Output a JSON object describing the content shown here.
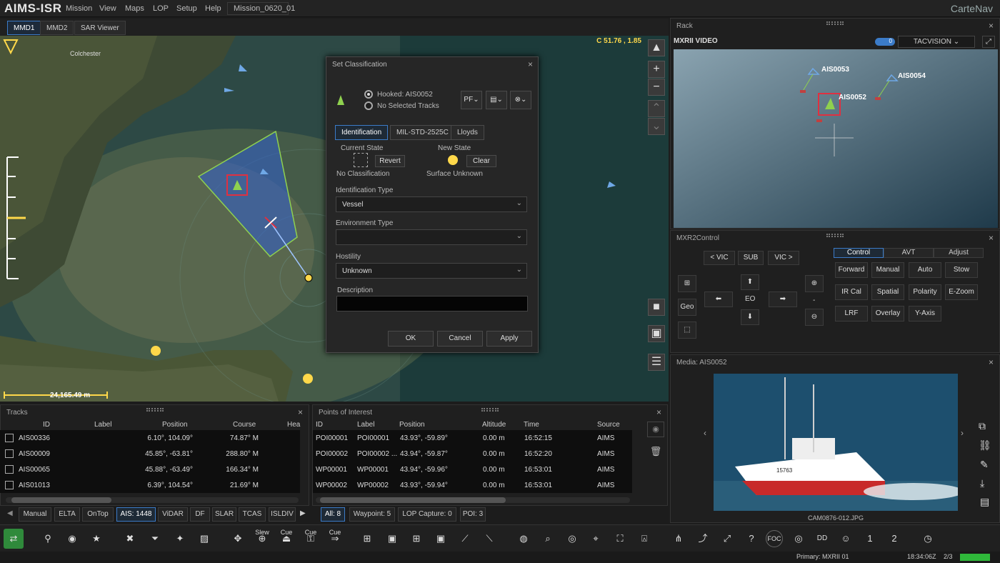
{
  "app": {
    "title": "AIMS-ISR",
    "menu": [
      "Mission",
      "View",
      "Maps",
      "LOP",
      "Setup",
      "Help"
    ],
    "mission": "Mission_0620_01",
    "brand": "CarteNav"
  },
  "map_tabs": [
    "MMD1",
    "MMD2",
    "SAR Viewer"
  ],
  "map": {
    "coordinate": "C 51.76  , 1.85",
    "scale": "24,165.49 m",
    "place_label": "Colchester"
  },
  "dialog": {
    "title": "Set Classification",
    "radio_hooked": "Hooked: AIS0052",
    "radio_none": "No Selected Tracks",
    "pf_label": "PF",
    "tabs": [
      "Identification",
      "MIL-STD-2525C",
      "Lloyds"
    ],
    "current_state_label": "Current State",
    "new_state_label": "New State",
    "revert": "Revert",
    "clear": "Clear",
    "current_state_value": "No Classification",
    "new_state_value": "Surface Unknown",
    "id_type_label": "Identification Type",
    "id_type_value": "Vessel",
    "env_type_label": "Environment Type",
    "env_type_value": "",
    "hostility_label": "Hostility",
    "hostility_value": "Unknown",
    "description_label": "Description",
    "ok": "OK",
    "cancel": "Cancel",
    "apply": "Apply"
  },
  "rack": {
    "title": "Rack",
    "video_title": "MXRII VIDEO",
    "toggle": "0",
    "dropdown": "TACVISION",
    "tracks": [
      "AIS0053",
      "AIS0054",
      "AIS0052"
    ]
  },
  "control": {
    "title": "MXR2Control",
    "nav": [
      "< VIC",
      "SUB",
      "VIC >"
    ],
    "tabs": [
      "Control",
      "AVT",
      "Adjust"
    ],
    "geo": "Geo",
    "eo": "EO",
    "minus": "-",
    "buttons": [
      [
        "Forward",
        "Manual",
        "Auto",
        "Stow"
      ],
      [
        "IR Cal",
        "Spatial",
        "Polarity",
        "E-Zoom"
      ],
      [
        "LRF",
        "Overlay",
        "Y-Axis"
      ]
    ]
  },
  "media": {
    "title": "Media: AIS0052",
    "filename": "CAM0876-012.JPG",
    "hull_number": "15763"
  },
  "tracks_panel": {
    "title": "Tracks",
    "columns": [
      "ID",
      "Label",
      "Position",
      "Course",
      "Hea"
    ],
    "rows": [
      [
        "AIS00336",
        "",
        "6.10°, 104.09°",
        "74.87° M"
      ],
      [
        "AIS00009",
        "",
        "45.85°, -63.81°",
        "288.80° M"
      ],
      [
        "AIS00065",
        "",
        "45.88°, -63.49°",
        "166.34° M"
      ],
      [
        "AIS01013",
        "",
        "6.39°, 104.54°",
        "21.69° M"
      ]
    ],
    "tabs": [
      "Manual",
      "ELTA",
      "OnTop",
      "AIS: 1448",
      "ViDAR",
      "DF",
      "SLAR",
      "TCAS",
      "ISLDIV"
    ]
  },
  "poi_panel": {
    "title": "Points of Interest",
    "columns": [
      "ID",
      "Label",
      "Position",
      "Altitude",
      "Time",
      "Source"
    ],
    "rows": [
      [
        "POI00001",
        "POI00001",
        "43.93°, -59.89°",
        "0.00 m",
        "16:52:15",
        "AIMS"
      ],
      [
        "POI00002",
        "POI00002 ...",
        "43.94°, -59.87°",
        "0.00 m",
        "16:52:20",
        "AIMS"
      ],
      [
        "WP00001",
        "WP00001",
        "43.94°, -59.96°",
        "0.00 m",
        "16:53:01",
        "AIMS"
      ],
      [
        "WP00002",
        "WP00002",
        "43.93°, -59.94°",
        "0.00 m",
        "16:53:01",
        "AIMS"
      ]
    ],
    "tabs": [
      "All: 8",
      "Waypoint: 5",
      "LOP Capture: 0",
      "POI: 3"
    ]
  },
  "toolbar": {
    "slew": "Slew",
    "cue1": "Cue",
    "cue2": "Cue",
    "cue3": "Cue",
    "foc": "FOC",
    "dd": "DD",
    "one": "1",
    "two": "2"
  },
  "status": {
    "primary": "Primary: MXRII 01",
    "time": "18:34:06Z",
    "page": "2/3"
  },
  "colors": {
    "accent": "#3b7bc8",
    "polygon_stroke": "#8fd14f",
    "track_red": "#e03040",
    "coord_yellow": "#ffd84a"
  }
}
